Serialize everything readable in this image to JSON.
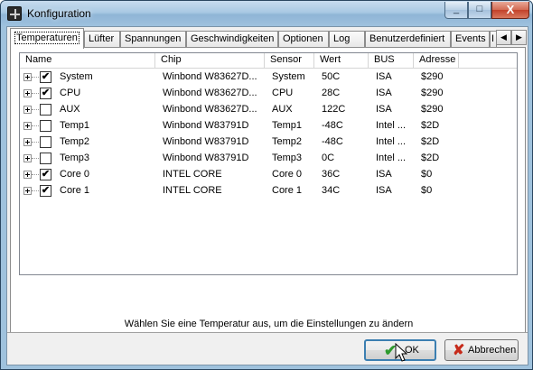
{
  "window": {
    "title": "Konfiguration",
    "minimize_glyph": "_",
    "maximize_glyph": "□",
    "close_glyph": "X"
  },
  "tabs": [
    {
      "label": "Temperaturen",
      "active": true
    },
    {
      "label": "Lüfter"
    },
    {
      "label": "Spannungen"
    },
    {
      "label": "Geschwindigkeiten"
    },
    {
      "label": "Optionen"
    },
    {
      "label": "Log"
    },
    {
      "label": "Benutzerdefiniert"
    },
    {
      "label": "Events"
    },
    {
      "label": "I"
    }
  ],
  "tab_scroll": {
    "left_icon": "◀",
    "right_icon": "▶"
  },
  "table": {
    "columns": [
      "Name",
      "Chip",
      "Sensor",
      "Wert",
      "BUS",
      "Adresse"
    ],
    "rows": [
      {
        "name": "System",
        "chip": "Winbond W83627D...",
        "sensor": "System",
        "wert": "50C",
        "bus": "ISA",
        "adresse": "$290",
        "checked": true,
        "check_glyph": "✔"
      },
      {
        "name": "CPU",
        "chip": "Winbond W83627D...",
        "sensor": "CPU",
        "wert": "28C",
        "bus": "ISA",
        "adresse": "$290",
        "checked": true,
        "check_glyph": "✔"
      },
      {
        "name": "AUX",
        "chip": "Winbond W83627D...",
        "sensor": "AUX",
        "wert": "122C",
        "bus": "ISA",
        "adresse": "$290",
        "checked": false,
        "check_glyph": ""
      },
      {
        "name": "Temp1",
        "chip": "Winbond W83791D",
        "sensor": "Temp1",
        "wert": "-48C",
        "bus": "Intel ...",
        "adresse": "$2D",
        "checked": false,
        "check_glyph": ""
      },
      {
        "name": "Temp2",
        "chip": "Winbond W83791D",
        "sensor": "Temp2",
        "wert": "-48C",
        "bus": "Intel ...",
        "adresse": "$2D",
        "checked": false,
        "check_glyph": ""
      },
      {
        "name": "Temp3",
        "chip": "Winbond W83791D",
        "sensor": "Temp3",
        "wert": "0C",
        "bus": "Intel ...",
        "adresse": "$2D",
        "checked": false,
        "check_glyph": ""
      },
      {
        "name": "Core 0",
        "chip": "INTEL CORE",
        "sensor": "Core 0",
        "wert": "36C",
        "bus": "ISA",
        "adresse": "$0",
        "checked": true,
        "check_glyph": "✔"
      },
      {
        "name": "Core 1",
        "chip": "INTEL CORE",
        "sensor": "Core 1",
        "wert": "34C",
        "bus": "ISA",
        "adresse": "$0",
        "checked": true,
        "check_glyph": "✔"
      }
    ]
  },
  "hint": "Wählen Sie eine Temperatur aus, um die Einstellungen zu ändern",
  "buttons": {
    "ok_label": "OK",
    "ok_icon": "✔",
    "cancel_label": "Abbrechen",
    "cancel_icon": "✘"
  },
  "icons": {
    "app": "app-icon",
    "ok": "checkmark-icon",
    "cancel": "cross-icon"
  }
}
